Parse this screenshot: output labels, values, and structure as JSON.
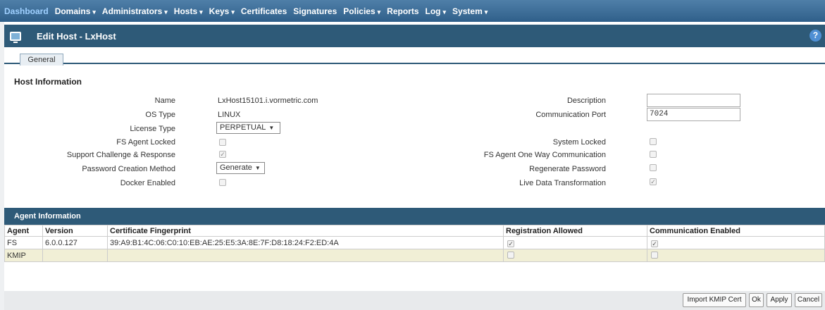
{
  "nav": {
    "items": [
      {
        "label": "Dashboard",
        "arrow": ""
      },
      {
        "label": "Domains",
        "arrow": "▾"
      },
      {
        "label": "Administrators",
        "arrow": "▾"
      },
      {
        "label": "Hosts",
        "arrow": "▾"
      },
      {
        "label": "Keys",
        "arrow": "▾"
      },
      {
        "label": "Certificates",
        "arrow": ""
      },
      {
        "label": "Signatures",
        "arrow": ""
      },
      {
        "label": "Policies",
        "arrow": "▾"
      },
      {
        "label": "Reports",
        "arrow": ""
      },
      {
        "label": "Log",
        "arrow": "▾"
      },
      {
        "label": "System",
        "arrow": "▾"
      }
    ]
  },
  "header": {
    "title": "Edit Host - LxHost",
    "help": "?"
  },
  "tabs": {
    "general": "General"
  },
  "host": {
    "section_title": "Host Information",
    "name_label": "Name",
    "name_value": "LxHost15101.i.vormetric.com",
    "os_label": "OS Type",
    "os_value": "LINUX",
    "license_label": "License Type",
    "license_value": "PERPETUAL",
    "fs_locked_label": "FS Agent Locked",
    "fs_locked_mark": "",
    "challenge_label": "Support Challenge & Response",
    "challenge_mark": "✓",
    "pwd_method_label": "Password Creation Method",
    "pwd_method_value": "Generate",
    "docker_label": "Docker Enabled",
    "docker_mark": "",
    "desc_label": "Description",
    "desc_value": "",
    "port_label": "Communication Port",
    "port_value": "7024",
    "sys_locked_label": "System Locked",
    "sys_locked_mark": "",
    "oneway_label": "FS Agent One Way Communication",
    "oneway_mark": "",
    "regen_label": "Regenerate Password",
    "regen_mark": "",
    "ldt_label": "Live Data Transformation",
    "ldt_mark": "✓"
  },
  "agent": {
    "section_title": "Agent Information",
    "columns": [
      "Agent",
      "Version",
      "Certificate Fingerprint",
      "Registration Allowed",
      "Communication Enabled"
    ],
    "rows": [
      {
        "agent": "FS",
        "version": "6.0.0.127",
        "fingerprint": "39:A9:B1:4C:06:C0:10:EB:AE:25:E5:3A:8E:7F:D8:18:24:F2:ED:4A",
        "reg": "✓",
        "comm": "✓"
      },
      {
        "agent": "KMIP",
        "version": "",
        "fingerprint": "",
        "reg": "",
        "comm": ""
      }
    ]
  },
  "buttons": {
    "import": "Import KMIP Cert",
    "ok": "Ok",
    "apply": "Apply",
    "cancel": "Cancel"
  },
  "colors": {
    "nav": "#3f6f99",
    "titlebar": "#2e5a78",
    "alt_row": "#f1efd6"
  }
}
